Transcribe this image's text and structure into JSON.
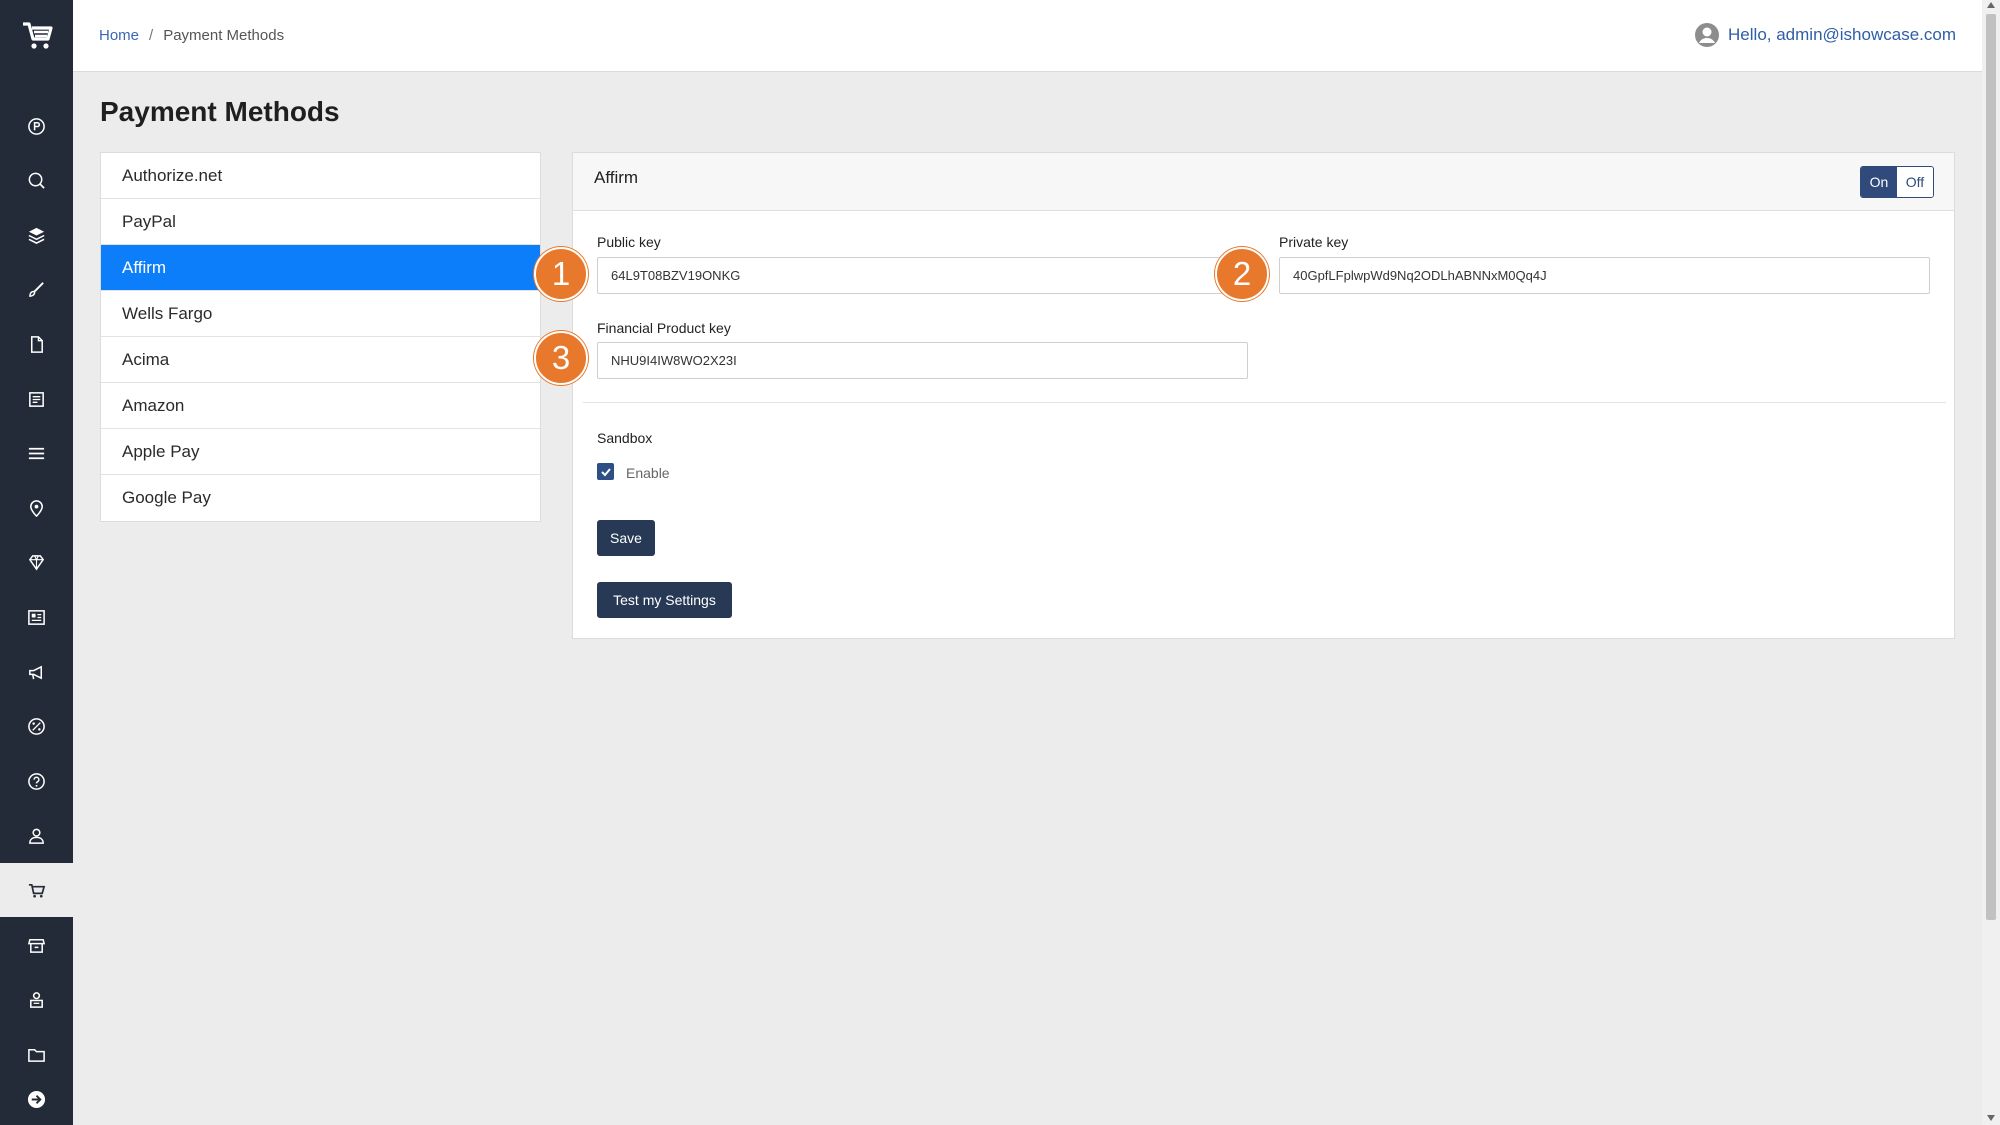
{
  "breadcrumb": {
    "home": "Home",
    "separator": "/",
    "current": "Payment Methods"
  },
  "user": {
    "greeting": "Hello, admin@ishowcase.com",
    "icon": "user-circle-icon"
  },
  "page": {
    "title": "Payment Methods"
  },
  "sidebar": {
    "icons": [
      "cart-logo-icon",
      "p-circle-icon",
      "seo-icon",
      "layers-icon",
      "brush-icon",
      "page-icon",
      "notes-icon",
      "menu-icon",
      "location-pin-icon",
      "gem-icon",
      "newsletter-icon",
      "megaphone-icon",
      "discount-icon",
      "help-icon",
      "user-icon",
      "cart-icon",
      "store-icon",
      "staff-icon",
      "folder-icon",
      "logout-arrow-icon"
    ],
    "active": "cart-icon"
  },
  "methods": [
    {
      "label": "Authorize.net"
    },
    {
      "label": "PayPal"
    },
    {
      "label": "Affirm",
      "active": true
    },
    {
      "label": "Wells Fargo"
    },
    {
      "label": "Acima"
    },
    {
      "label": "Amazon"
    },
    {
      "label": "Apple Pay"
    },
    {
      "label": "Google Pay"
    }
  ],
  "panel": {
    "title": "Affirm",
    "toggle": {
      "on": "On",
      "off": "Off",
      "state": "On"
    },
    "public_key": {
      "label": "Public key",
      "value": "64L9T08BZV19ONKG"
    },
    "private_key": {
      "label": "Private key",
      "value": "40GpfLFplwpWd9Nq2ODLhABNNxM0Qq4J"
    },
    "financial_key": {
      "label": "Financial Product key",
      "value": "NHU9I4IW8WO2X23I"
    },
    "sandbox": {
      "label": "Sandbox",
      "enable_label": "Enable",
      "checked": true
    },
    "save_label": "Save",
    "test_label": "Test my Settings"
  },
  "annotations": [
    "1",
    "2",
    "3"
  ],
  "colors": {
    "sidebar": "#232b38",
    "accent": "#0d7ef9",
    "button": "#283956",
    "badge": "#e8782c"
  }
}
